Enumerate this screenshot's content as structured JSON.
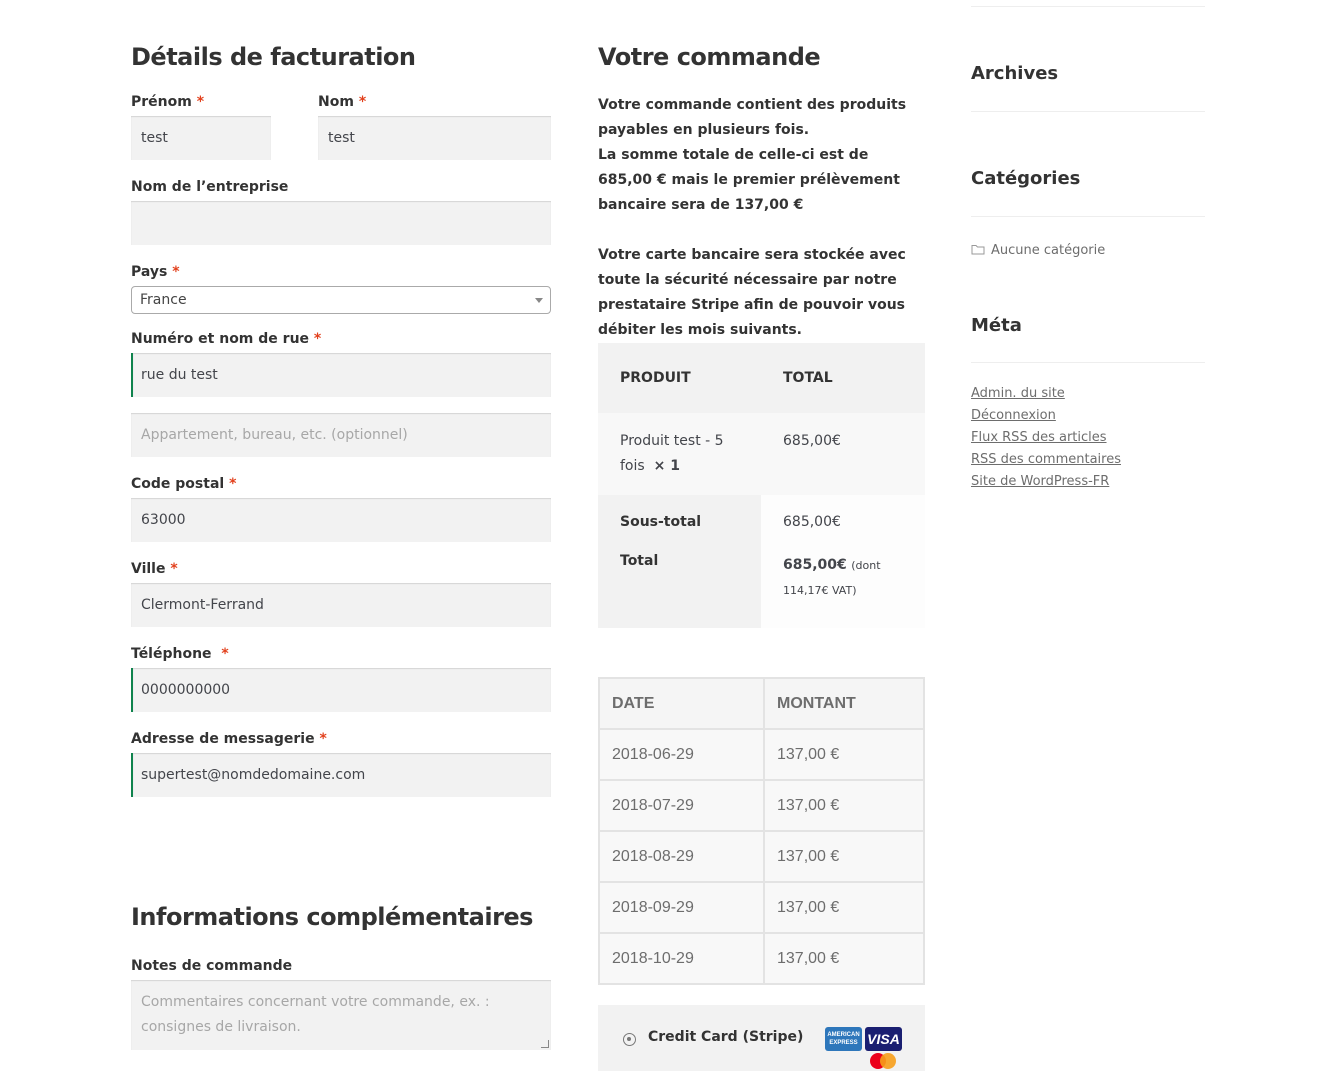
{
  "billing": {
    "title": "Détails de facturation",
    "required_mark": "*",
    "first_name": {
      "label": "Prénom",
      "value": "test"
    },
    "last_name": {
      "label": "Nom",
      "value": "test"
    },
    "company": {
      "label": "Nom de l’entreprise",
      "value": ""
    },
    "country": {
      "label": "Pays",
      "value": "France"
    },
    "street": {
      "label": "Numéro et nom de rue",
      "value": "rue du test"
    },
    "street2": {
      "placeholder": "Appartement, bureau, etc. (optionnel)"
    },
    "postcode": {
      "label": "Code postal",
      "value": "63000"
    },
    "city": {
      "label": "Ville",
      "value": "Clermont-Ferrand"
    },
    "phone": {
      "label": "Téléphone",
      "value": "0000000000"
    },
    "email": {
      "label": "Adresse de messagerie",
      "value": "supertest@nomdedomaine.com"
    }
  },
  "additional": {
    "title": "Informations complémentaires",
    "notes_label": "Notes de commande",
    "notes_placeholder": "Commentaires concernant votre commande, ex. : consignes de livraison."
  },
  "order": {
    "title": "Votre commande",
    "notice_1": "Votre commande contient des produits payables en plusieurs fois.",
    "notice_2": "La somme totale de celle-ci est de 685,00 € mais le premier prélèvement bancaire sera de 137,00 €",
    "notice_3": "Votre carte bancaire sera stockée avec toute la sécurité nécessaire par notre prestataire Stripe afin de pouvoir vous débiter les mois suivants.",
    "col_product": "Produit",
    "col_total": "Total",
    "item_name": "Produit test - 5 fois",
    "item_qty": "× 1",
    "item_total": "685,00€",
    "subtotal_label": "Sous-total",
    "subtotal_value": "685,00€",
    "total_label": "Total",
    "total_value": "685,00€",
    "total_tax": "(dont 114,17€ VAT)"
  },
  "schedule": {
    "col_date": "Date",
    "col_amount": "Montant",
    "rows": [
      {
        "date": "2018-06-29",
        "amount": "137,00 €"
      },
      {
        "date": "2018-07-29",
        "amount": "137,00 €"
      },
      {
        "date": "2018-08-29",
        "amount": "137,00 €"
      },
      {
        "date": "2018-09-29",
        "amount": "137,00 €"
      },
      {
        "date": "2018-10-29",
        "amount": "137,00 €"
      }
    ]
  },
  "payment": {
    "method_label": "Credit Card (Stripe)",
    "amex": "AMERICAN EXPRESS",
    "visa": "VISA"
  },
  "sidebar": {
    "archives_title": "Archives",
    "categories_title": "Catégories",
    "no_category": "Aucune catégorie",
    "meta_title": "Méta",
    "meta_links": [
      "Admin. du site",
      "Déconnexion",
      "Flux RSS des articles",
      "RSS des commentaires",
      "Site de WordPress-FR"
    ]
  },
  "colors": {
    "required": "#e2401c",
    "valid_border": "#0f834d",
    "field_bg": "#f2f2f2"
  }
}
